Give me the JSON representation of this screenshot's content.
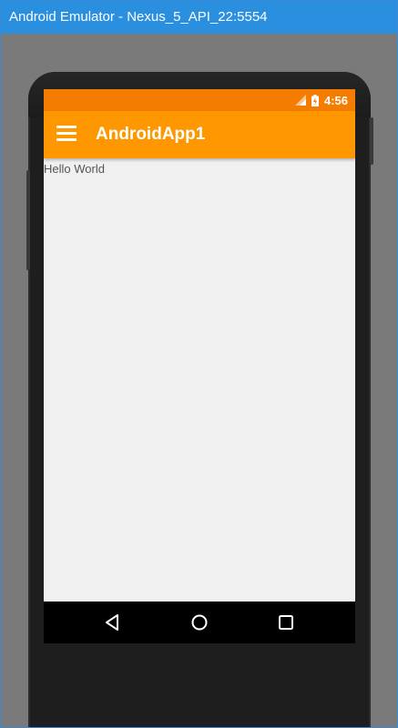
{
  "window": {
    "title": "Android Emulator - Nexus_5_API_22:5554"
  },
  "statusbar": {
    "time": "4:56",
    "color": "#f47c00"
  },
  "appbar": {
    "title": "AndroidApp1",
    "color": "#ff9800"
  },
  "content": {
    "text": "Hello World"
  },
  "navbar": {
    "buttons": [
      "back-icon",
      "home-icon",
      "recents-icon"
    ]
  }
}
